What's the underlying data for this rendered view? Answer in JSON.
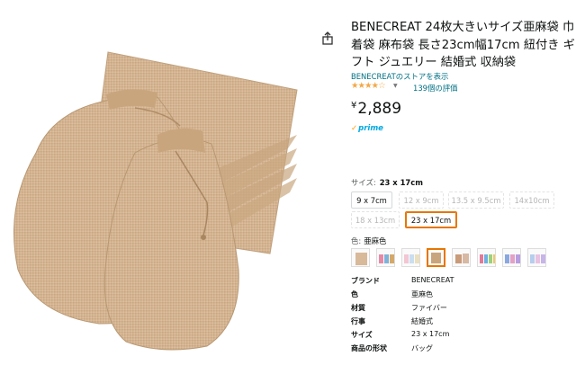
{
  "product": {
    "title": "BENECREAT 24枚大きいサイズ亜麻袋 巾着袋 麻布袋 長さ23cm幅17cm 紐付き ギフト ジュエリー 結婚式 収納袋",
    "store_link": "BENECREATのストアを表示",
    "rating_stars": "★★★★☆",
    "reviews": "139個の評価",
    "currency": "¥",
    "price": "2,889",
    "prime": "prime"
  },
  "size": {
    "label": "サイズ:",
    "selected": "23 x 17cm",
    "options": [
      {
        "label": "9 x 7cm",
        "state": "available"
      },
      {
        "label": "12 x 9cm",
        "state": "disabled"
      },
      {
        "label": "13.5 x 9.5cm",
        "state": "disabled"
      },
      {
        "label": "14x10cm",
        "state": "disabled"
      },
      {
        "label": "18 x 13cm",
        "state": "disabled"
      },
      {
        "label": "23 x 17cm",
        "state": "selected"
      }
    ]
  },
  "color": {
    "label": "色:",
    "selected": "亜麻色",
    "swatches": [
      "beige-bag",
      "multicolor-bags",
      "pastel-bags",
      "linen-bag",
      "gift-bags",
      "colorful-bags",
      "blue-pink-bags",
      "pastel-mix-bags"
    ]
  },
  "specs": [
    {
      "key": "ブランド",
      "value": "BENECREAT"
    },
    {
      "key": "色",
      "value": "亜麻色"
    },
    {
      "key": "材質",
      "value": "ファイバー"
    },
    {
      "key": "行事",
      "value": "結婚式"
    },
    {
      "key": "サイズ",
      "value": "23 x 17cm"
    },
    {
      "key": "商品の形状",
      "value": "バッグ"
    }
  ],
  "colors": {
    "accent": "#e77600",
    "link": "#007185",
    "star": "#f3a847",
    "prime": "#00a8e1",
    "burlap": "#d1b08c"
  }
}
